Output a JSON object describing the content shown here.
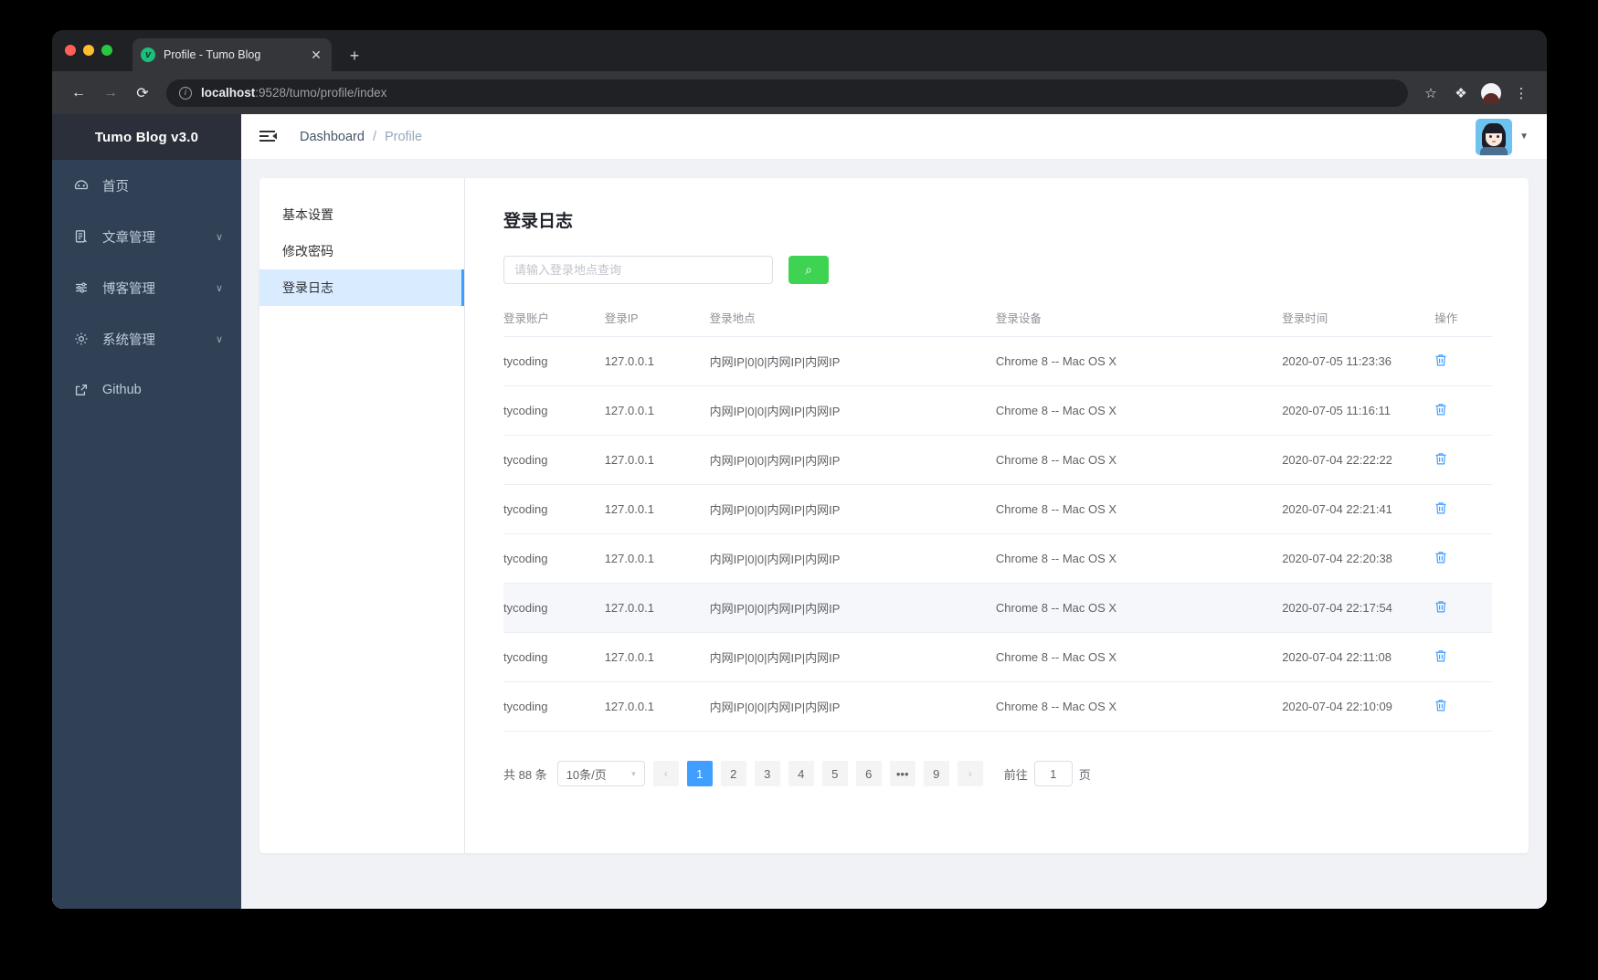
{
  "browser": {
    "tab_title": "Profile - Tumo Blog",
    "favicon_letter": "v",
    "close_label": "✕",
    "new_tab_label": "+",
    "back_label": "←",
    "forward_label": "→",
    "reload_label": "⟳",
    "info_label": "i",
    "url_host": "localhost",
    "url_path": ":9528/tumo/profile/index",
    "star_icon": "☆",
    "extensions_icon": "❖",
    "menu_icon": "⋮"
  },
  "sidebar": {
    "logo": "Tumo Blog v3.0",
    "items": [
      {
        "label": "首页",
        "icon": "dashboard-icon",
        "has_arrow": false
      },
      {
        "label": "文章管理",
        "icon": "document-icon",
        "has_arrow": true
      },
      {
        "label": "博客管理",
        "icon": "sliders-icon",
        "has_arrow": true
      },
      {
        "label": "系统管理",
        "icon": "gear-icon",
        "has_arrow": true
      },
      {
        "label": "Github",
        "icon": "external-link-icon",
        "has_arrow": false
      }
    ],
    "arrow_glyph": "∨"
  },
  "navbar": {
    "breadcrumb_root": "Dashboard",
    "breadcrumb_sep": "/",
    "breadcrumb_current": "Profile",
    "avatar_caret": "▼"
  },
  "tabs": {
    "items": [
      {
        "label": "基本设置",
        "active": false
      },
      {
        "label": "修改密码",
        "active": false
      },
      {
        "label": "登录日志",
        "active": true
      }
    ]
  },
  "pane": {
    "title": "登录日志",
    "search_placeholder": "请输入登录地点查询",
    "search_value": "",
    "search_button_icon": "⌕",
    "accent_green": "#3fd353",
    "accent_blue": "#409eff"
  },
  "table": {
    "headers": [
      "登录账户",
      "登录IP",
      "登录地点",
      "登录设备",
      "登录时间",
      "操作"
    ],
    "delete_icon": "🗑",
    "rows": [
      {
        "user": "tycoding",
        "ip": "127.0.0.1",
        "location": "内网IP|0|0|内网IP|内网IP",
        "device": "Chrome 8 -- Mac OS X",
        "time": "2020-07-05 11:23:36",
        "highlight": false
      },
      {
        "user": "tycoding",
        "ip": "127.0.0.1",
        "location": "内网IP|0|0|内网IP|内网IP",
        "device": "Chrome 8 -- Mac OS X",
        "time": "2020-07-05 11:16:11",
        "highlight": false
      },
      {
        "user": "tycoding",
        "ip": "127.0.0.1",
        "location": "内网IP|0|0|内网IP|内网IP",
        "device": "Chrome 8 -- Mac OS X",
        "time": "2020-07-04 22:22:22",
        "highlight": false
      },
      {
        "user": "tycoding",
        "ip": "127.0.0.1",
        "location": "内网IP|0|0|内网IP|内网IP",
        "device": "Chrome 8 -- Mac OS X",
        "time": "2020-07-04 22:21:41",
        "highlight": false
      },
      {
        "user": "tycoding",
        "ip": "127.0.0.1",
        "location": "内网IP|0|0|内网IP|内网IP",
        "device": "Chrome 8 -- Mac OS X",
        "time": "2020-07-04 22:20:38",
        "highlight": false
      },
      {
        "user": "tycoding",
        "ip": "127.0.0.1",
        "location": "内网IP|0|0|内网IP|内网IP",
        "device": "Chrome 8 -- Mac OS X",
        "time": "2020-07-04 22:17:54",
        "highlight": true
      },
      {
        "user": "tycoding",
        "ip": "127.0.0.1",
        "location": "内网IP|0|0|内网IP|内网IP",
        "device": "Chrome 8 -- Mac OS X",
        "time": "2020-07-04 22:11:08",
        "highlight": false
      },
      {
        "user": "tycoding",
        "ip": "127.0.0.1",
        "location": "内网IP|0|0|内网IP|内网IP",
        "device": "Chrome 8 -- Mac OS X",
        "time": "2020-07-04 22:10:09",
        "highlight": false
      }
    ]
  },
  "pagination": {
    "total_label": "共 88 条",
    "page_size_label": "10条/页",
    "prev_glyph": "‹",
    "next_glyph": "›",
    "pages": [
      "1",
      "2",
      "3",
      "4",
      "5",
      "6",
      "•••",
      "9"
    ],
    "active_page": "1",
    "jump_prefix": "前往",
    "jump_value": "1",
    "jump_suffix": "页"
  }
}
